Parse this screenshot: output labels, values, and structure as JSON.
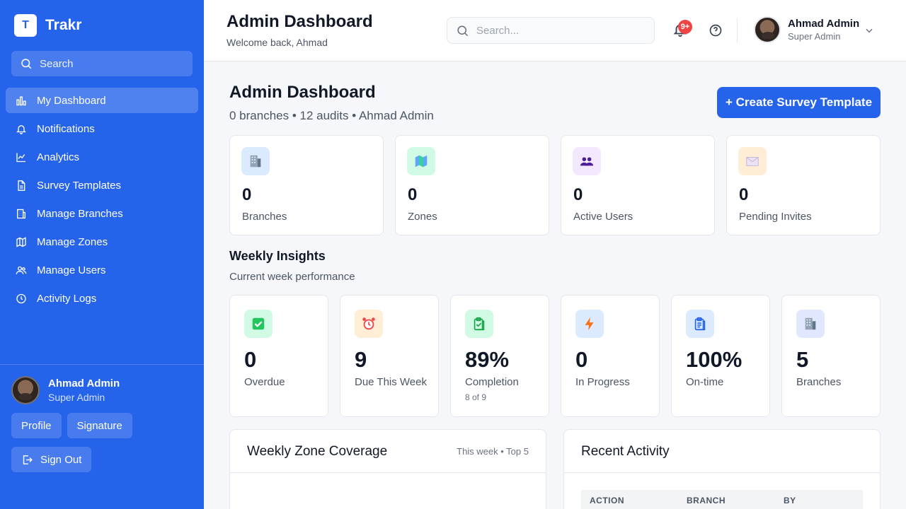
{
  "app": {
    "logo_letter": "T",
    "name": "Trakr"
  },
  "sidebar": {
    "search_label": "Search",
    "items": [
      {
        "label": "My Dashboard",
        "icon": "bar-chart-icon",
        "active": true
      },
      {
        "label": "Notifications",
        "icon": "bell-icon"
      },
      {
        "label": "Analytics",
        "icon": "line-chart-icon"
      },
      {
        "label": "Survey Templates",
        "icon": "file-icon"
      },
      {
        "label": "Manage Branches",
        "icon": "building-icon"
      },
      {
        "label": "Manage Zones",
        "icon": "map-icon"
      },
      {
        "label": "Manage Users",
        "icon": "users-icon"
      },
      {
        "label": "Activity Logs",
        "icon": "clock-icon"
      }
    ],
    "user": {
      "name": "Ahmad Admin",
      "role": "Super Admin"
    },
    "profile_label": "Profile",
    "signature_label": "Signature",
    "signout_label": "Sign Out"
  },
  "header": {
    "title": "Admin Dashboard",
    "subtitle": "Welcome back, Ahmad",
    "search_placeholder": "Search...",
    "notification_badge": "9+",
    "user": {
      "name": "Ahmad Admin",
      "role": "Super Admin"
    }
  },
  "main": {
    "title": "Admin Dashboard",
    "meta": "0 branches • 12 audits • Ahmad Admin",
    "create_label": "+ Create Survey Template",
    "stats": [
      {
        "value": "0",
        "label": "Branches",
        "icon": "office-building-icon",
        "bg": "#dbeafe"
      },
      {
        "value": "0",
        "label": "Zones",
        "icon": "map-icon",
        "bg": "#d1fae5"
      },
      {
        "value": "0",
        "label": "Active Users",
        "icon": "people-icon",
        "bg": "#f3e8ff"
      },
      {
        "value": "0",
        "label": "Pending Invites",
        "icon": "envelope-icon",
        "bg": "#ffedd5"
      }
    ],
    "insights_title": "Weekly Insights",
    "insights_sub": "Current week performance",
    "insights": [
      {
        "value": "0",
        "label": "Overdue",
        "icon": "check-box-icon",
        "bg": "#d1fae5"
      },
      {
        "value": "9",
        "label": "Due This Week",
        "icon": "alarm-clock-icon",
        "bg": "#ffedd5"
      },
      {
        "value": "89%",
        "label": "Completion",
        "sub": "8 of 9",
        "icon": "clipboard-check-icon",
        "bg": "#d1fae5"
      },
      {
        "value": "0",
        "label": "In Progress",
        "icon": "lightning-icon",
        "bg": "#dbeafe"
      },
      {
        "value": "100%",
        "label": "On-time",
        "icon": "clipboard-list-icon",
        "bg": "#dbeafe"
      },
      {
        "value": "5",
        "label": "Branches",
        "icon": "office-building-icon",
        "bg": "#e0e7ff"
      }
    ],
    "zone_panel": {
      "title": "Weekly Zone Coverage",
      "meta": "This week • Top 5"
    },
    "activity_panel": {
      "title": "Recent Activity",
      "columns": [
        "ACTION",
        "BRANCH",
        "BY"
      ]
    }
  },
  "colors": {
    "primary": "#2563eb",
    "badge": "#ef4444"
  }
}
